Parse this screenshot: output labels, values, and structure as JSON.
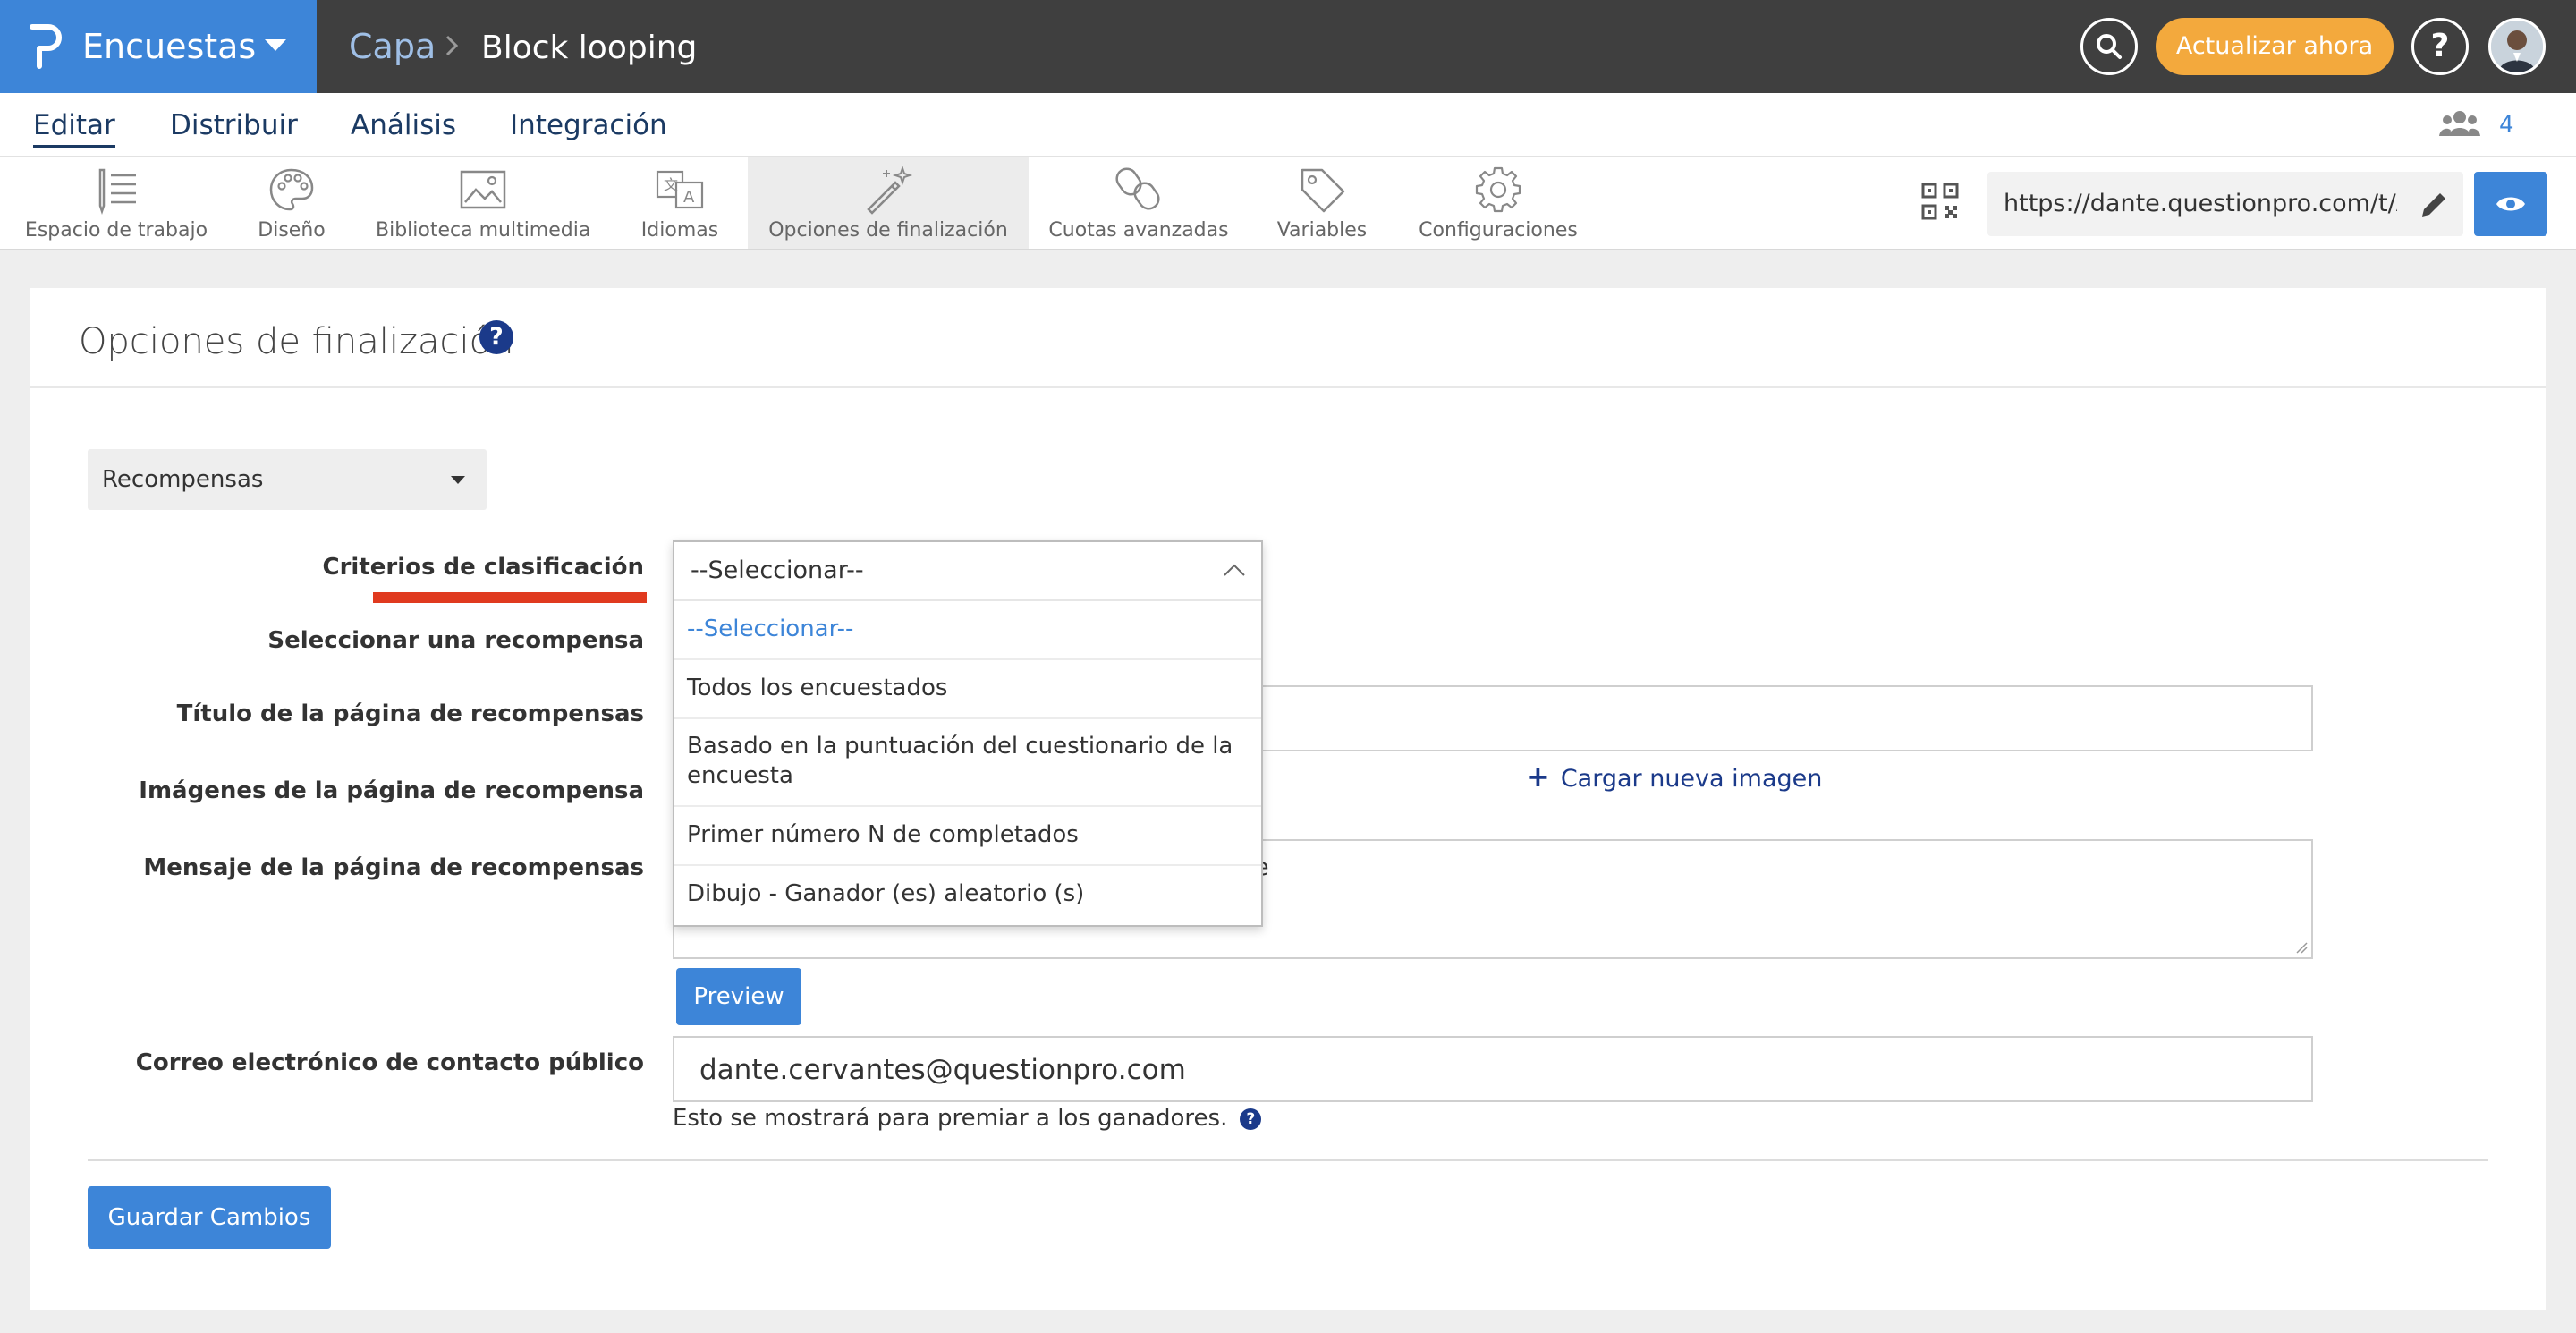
{
  "topbar": {
    "brand": "Encuestas",
    "crumb_root": "Capa",
    "crumb_current": "Block looping",
    "upgrade_label": "Actualizar ahora",
    "help_label": "?"
  },
  "nav": {
    "items": [
      {
        "label": "Editar",
        "active": true
      },
      {
        "label": "Distribuir"
      },
      {
        "label": "Análisis"
      },
      {
        "label": "Integración"
      }
    ],
    "user_count": "4"
  },
  "toolbar": {
    "tools": [
      {
        "label": "Espacio de trabajo",
        "icon": "workspace-icon"
      },
      {
        "label": "Diseño",
        "icon": "palette-icon"
      },
      {
        "label": "Biblioteca multimedia",
        "icon": "image-icon"
      },
      {
        "label": "Idiomas",
        "icon": "language-icon"
      },
      {
        "label": "Opciones de finalización",
        "icon": "magic-wand-icon",
        "active": true
      },
      {
        "label": "Cuotas avanzadas",
        "icon": "quota-icon"
      },
      {
        "label": "Variables",
        "icon": "tag-icon"
      },
      {
        "label": "Configuraciones",
        "icon": "gear-icon"
      }
    ],
    "url": "https://dante.questionpro.com/t/AS"
  },
  "panel": {
    "title": "Opciones de finalización",
    "help": "?",
    "type_select": "Recompensas",
    "labels": {
      "criteria": "Criterios de clasificación",
      "reward": "Seleccionar una recompensa",
      "page_title": "Título de la página de recompensas",
      "images": "Imágenes de la página de recompensa",
      "message": "Mensaje de la página de recompensas",
      "email": "Correo electrónico de contacto público"
    },
    "upload_label": "Cargar nueva imagen",
    "message_tail": "e",
    "preview_label": "Preview",
    "email_value": "dante.cervantes@questionpro.com",
    "email_helper": "Esto se mostrará para premiar a los ganadores.",
    "helper_icon": "?",
    "save_label": "Guardar Cambios"
  },
  "dropdown": {
    "current": "--Seleccionar--",
    "options": [
      "--Seleccionar--",
      "Todos los encuestados",
      "Basado en la puntuación del cuestionario de la encuesta",
      "Primer número N de completados",
      "Dibujo - Ganador (es) aleatorio (s)"
    ]
  },
  "colors": {
    "brand_blue": "#3d85d8",
    "topbar": "#3f3f3f",
    "upgrade_orange": "#f3a93d",
    "navy": "#1b3a63",
    "required_red": "#e03a1f"
  }
}
